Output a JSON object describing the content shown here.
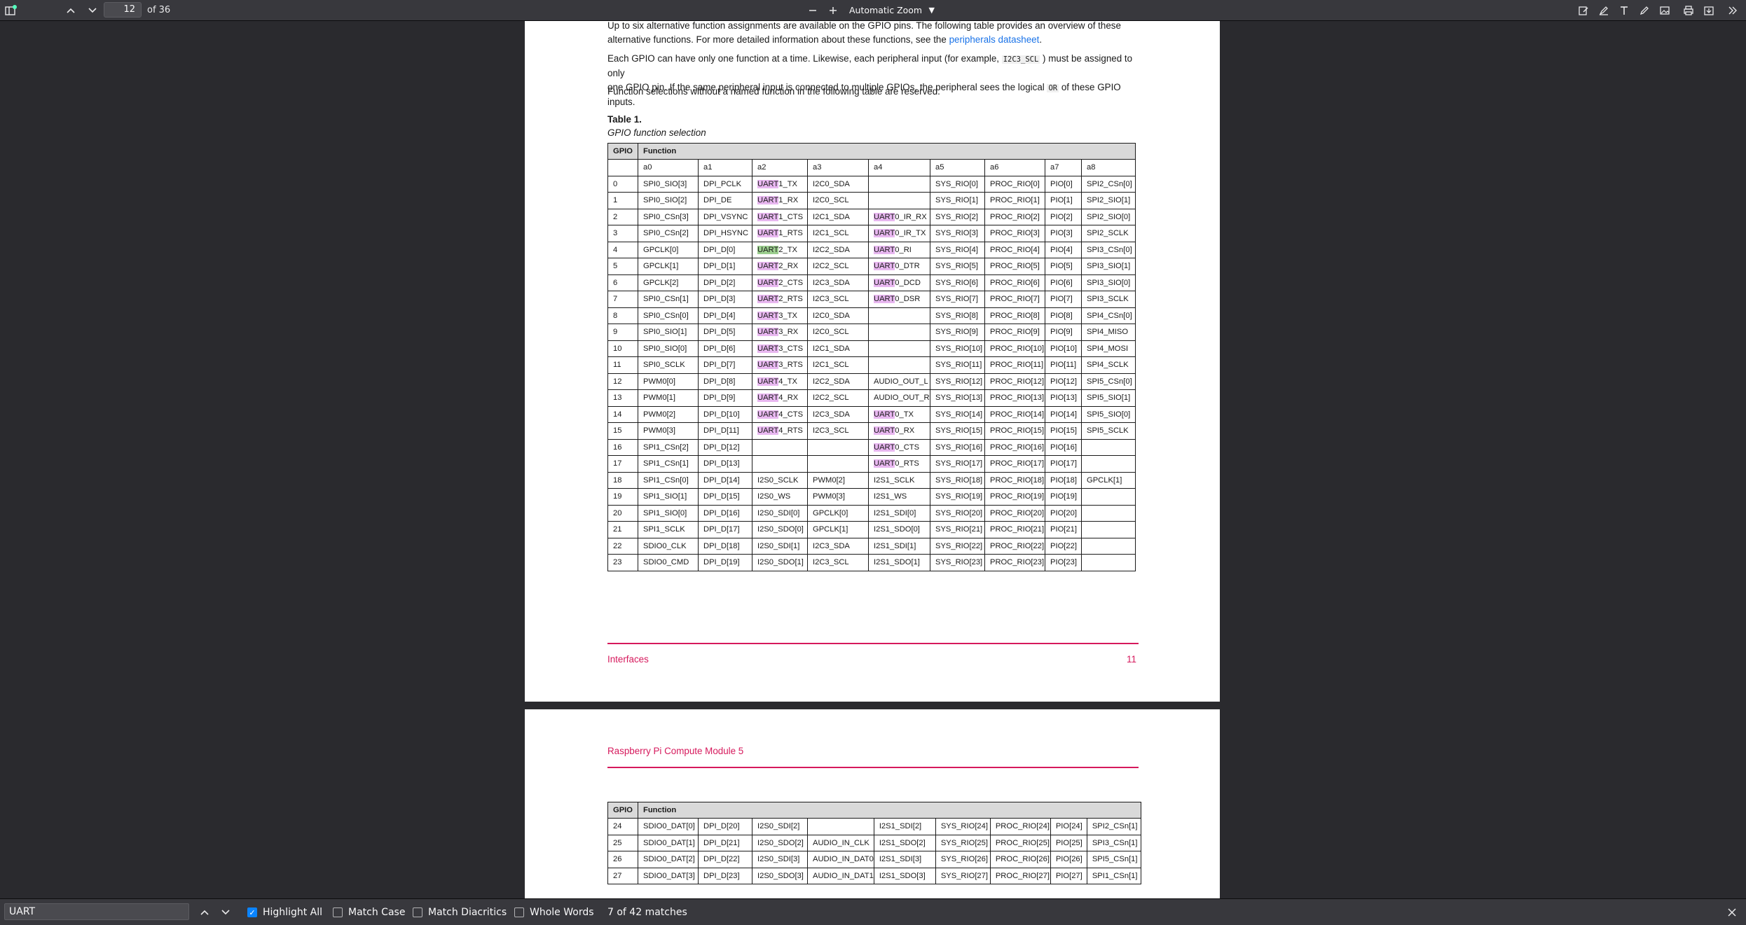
{
  "toolbar": {
    "page_number": "12",
    "page_count": "of 36",
    "zoom": "Automatic Zoom",
    "icons": [
      "sidebar-toggle-icon",
      "previous-page-icon",
      "next-page-icon",
      "zoom-out-icon",
      "zoom-in-icon",
      "annotate-icon",
      "highlight-icon",
      "text-icon",
      "draw-icon",
      "image-icon",
      "print-icon",
      "save-icon",
      "tools-menu-icon"
    ]
  },
  "page1": {
    "para1_a": "Up to six alternative function assignments are available on the GPIO pins. The following table provides an overview of these",
    "para1_b": "alternative functions. For more detailed information about these functions, see the ",
    "para1_link": "peripherals datasheet",
    "para1_end": ".",
    "para2_a": "Each GPIO can have only one function at a time. Likewise, each peripheral input (for example, ",
    "para2_code": "I2C3_SCL",
    "para2_b": ") must be assigned to only",
    "para2_c": "one GPIO pin. If the same peripheral input is connected to multiple GPIOs, the peripheral sees the logical ",
    "para2_code2": "OR",
    "para2_d": " of these GPIO inputs.",
    "para3": "Function selections without a named function in the following table are reserved.",
    "table_label": "Table 1.",
    "table_caption": "GPIO function selection",
    "col_gpio": "GPIO",
    "col_function": "Function",
    "alt_headers": [
      "a0",
      "a1",
      "a2",
      "a3",
      "a4",
      "a5",
      "a6",
      "a7",
      "a8"
    ],
    "rows": [
      [
        "0",
        "SPI0_SIO[3]",
        "DPI_PCLK",
        "UART1_TX",
        "I2C0_SDA",
        "",
        "SYS_RIO[0]",
        "PROC_RIO[0]",
        "PIO[0]",
        "SPI2_CSn[0]"
      ],
      [
        "1",
        "SPI0_SIO[2]",
        "DPI_DE",
        "UART1_RX",
        "I2C0_SCL",
        "",
        "SYS_RIO[1]",
        "PROC_RIO[1]",
        "PIO[1]",
        "SPI2_SIO[1]"
      ],
      [
        "2",
        "SPI0_CSn[3]",
        "DPI_VSYNC",
        "UART1_CTS",
        "I2C1_SDA",
        "UART0_IR_RX",
        "SYS_RIO[2]",
        "PROC_RIO[2]",
        "PIO[2]",
        "SPI2_SIO[0]"
      ],
      [
        "3",
        "SPI0_CSn[2]",
        "DPI_HSYNC",
        "UART1_RTS",
        "I2C1_SCL",
        "UART0_IR_TX",
        "SYS_RIO[3]",
        "PROC_RIO[3]",
        "PIO[3]",
        "SPI2_SCLK"
      ],
      [
        "4",
        "GPCLK[0]",
        "DPI_D[0]",
        "UART2_TX",
        "I2C2_SDA",
        "UART0_RI",
        "SYS_RIO[4]",
        "PROC_RIO[4]",
        "PIO[4]",
        "SPI3_CSn[0]"
      ],
      [
        "5",
        "GPCLK[1]",
        "DPI_D[1]",
        "UART2_RX",
        "I2C2_SCL",
        "UART0_DTR",
        "SYS_RIO[5]",
        "PROC_RIO[5]",
        "PIO[5]",
        "SPI3_SIO[1]"
      ],
      [
        "6",
        "GPCLK[2]",
        "DPI_D[2]",
        "UART2_CTS",
        "I2C3_SDA",
        "UART0_DCD",
        "SYS_RIO[6]",
        "PROC_RIO[6]",
        "PIO[6]",
        "SPI3_SIO[0]"
      ],
      [
        "7",
        "SPI0_CSn[1]",
        "DPI_D[3]",
        "UART2_RTS",
        "I2C3_SCL",
        "UART0_DSR",
        "SYS_RIO[7]",
        "PROC_RIO[7]",
        "PIO[7]",
        "SPI3_SCLK"
      ],
      [
        "8",
        "SPI0_CSn[0]",
        "DPI_D[4]",
        "UART3_TX",
        "I2C0_SDA",
        "",
        "SYS_RIO[8]",
        "PROC_RIO[8]",
        "PIO[8]",
        "SPI4_CSn[0]"
      ],
      [
        "9",
        "SPI0_SIO[1]",
        "DPI_D[5]",
        "UART3_RX",
        "I2C0_SCL",
        "",
        "SYS_RIO[9]",
        "PROC_RIO[9]",
        "PIO[9]",
        "SPI4_MISO"
      ],
      [
        "10",
        "SPI0_SIO[0]",
        "DPI_D[6]",
        "UART3_CTS",
        "I2C1_SDA",
        "",
        "SYS_RIO[10]",
        "PROC_RIO[10]",
        "PIO[10]",
        "SPI4_MOSI"
      ],
      [
        "11",
        "SPI0_SCLK",
        "DPI_D[7]",
        "UART3_RTS",
        "I2C1_SCL",
        "",
        "SYS_RIO[11]",
        "PROC_RIO[11]",
        "PIO[11]",
        "SPI4_SCLK"
      ],
      [
        "12",
        "PWM0[0]",
        "DPI_D[8]",
        "UART4_TX",
        "I2C2_SDA",
        "AUDIO_OUT_L",
        "SYS_RIO[12]",
        "PROC_RIO[12]",
        "PIO[12]",
        "SPI5_CSn[0]"
      ],
      [
        "13",
        "PWM0[1]",
        "DPI_D[9]",
        "UART4_RX",
        "I2C2_SCL",
        "AUDIO_OUT_R",
        "SYS_RIO[13]",
        "PROC_RIO[13]",
        "PIO[13]",
        "SPI5_SIO[1]"
      ],
      [
        "14",
        "PWM0[2]",
        "DPI_D[10]",
        "UART4_CTS",
        "I2C3_SDA",
        "UART0_TX",
        "SYS_RIO[14]",
        "PROC_RIO[14]",
        "PIO[14]",
        "SPI5_SIO[0]"
      ],
      [
        "15",
        "PWM0[3]",
        "DPI_D[11]",
        "UART4_RTS",
        "I2C3_SCL",
        "UART0_RX",
        "SYS_RIO[15]",
        "PROC_RIO[15]",
        "PIO[15]",
        "SPI5_SCLK"
      ],
      [
        "16",
        "SPI1_CSn[2]",
        "DPI_D[12]",
        "",
        "",
        "UART0_CTS",
        "SYS_RIO[16]",
        "PROC_RIO[16]",
        "PIO[16]",
        ""
      ],
      [
        "17",
        "SPI1_CSn[1]",
        "DPI_D[13]",
        "",
        "",
        "UART0_RTS",
        "SYS_RIO[17]",
        "PROC_RIO[17]",
        "PIO[17]",
        ""
      ],
      [
        "18",
        "SPI1_CSn[0]",
        "DPI_D[14]",
        "I2S0_SCLK",
        "PWM0[2]",
        "I2S1_SCLK",
        "SYS_RIO[18]",
        "PROC_RIO[18]",
        "PIO[18]",
        "GPCLK[1]"
      ],
      [
        "19",
        "SPI1_SIO[1]",
        "DPI_D[15]",
        "I2S0_WS",
        "PWM0[3]",
        "I2S1_WS",
        "SYS_RIO[19]",
        "PROC_RIO[19]",
        "PIO[19]",
        ""
      ],
      [
        "20",
        "SPI1_SIO[0]",
        "DPI_D[16]",
        "I2S0_SDI[0]",
        "GPCLK[0]",
        "I2S1_SDI[0]",
        "SYS_RIO[20]",
        "PROC_RIO[20]",
        "PIO[20]",
        ""
      ],
      [
        "21",
        "SPI1_SCLK",
        "DPI_D[17]",
        "I2S0_SDO[0]",
        "GPCLK[1]",
        "I2S1_SDO[0]",
        "SYS_RIO[21]",
        "PROC_RIO[21]",
        "PIO[21]",
        ""
      ],
      [
        "22",
        "SDIO0_CLK",
        "DPI_D[18]",
        "I2S0_SDI[1]",
        "I2C3_SDA",
        "I2S1_SDI[1]",
        "SYS_RIO[22]",
        "PROC_RIO[22]",
        "PIO[22]",
        ""
      ],
      [
        "23",
        "SDIO0_CMD",
        "DPI_D[19]",
        "I2S0_SDO[1]",
        "I2C3_SCL",
        "I2S1_SDO[1]",
        "SYS_RIO[23]",
        "PROC_RIO[23]",
        "PIO[23]",
        ""
      ]
    ],
    "footer_left": "Interfaces",
    "footer_right": "11"
  },
  "page2": {
    "header": "Raspberry Pi Compute Module 5",
    "col_gpio": "GPIO",
    "col_function": "Function",
    "rows": [
      [
        "24",
        "SDIO0_DAT[0]",
        "DPI_D[20]",
        "I2S0_SDI[2]",
        "",
        "I2S1_SDI[2]",
        "SYS_RIO[24]",
        "PROC_RIO[24]",
        "PIO[24]",
        "SPI2_CSn[1]"
      ],
      [
        "25",
        "SDIO0_DAT[1]",
        "DPI_D[21]",
        "I2S0_SDO[2]",
        "AUDIO_IN_CLK",
        "I2S1_SDO[2]",
        "SYS_RIO[25]",
        "PROC_RIO[25]",
        "PIO[25]",
        "SPI3_CSn[1]"
      ],
      [
        "26",
        "SDIO0_DAT[2]",
        "DPI_D[22]",
        "I2S0_SDI[3]",
        "AUDIO_IN_DAT0",
        "I2S1_SDI[3]",
        "SYS_RIO[26]",
        "PROC_RIO[26]",
        "PIO[26]",
        "SPI5_CSn[1]"
      ],
      [
        "27",
        "SDIO0_DAT[3]",
        "DPI_D[23]",
        "I2S0_SDO[3]",
        "AUDIO_IN_DAT1",
        "I2S1_SDO[3]",
        "SYS_RIO[27]",
        "PROC_RIO[27]",
        "PIO[27]",
        "SPI1_CSn[1]"
      ]
    ]
  },
  "findbar": {
    "query": "UART",
    "highlight_all": "Highlight All",
    "match_case": "Match Case",
    "match_diacritics": "Match Diacritics",
    "whole_words": "Whole Words",
    "result": "7 of 42 matches",
    "highlight_color": "#e8b7f0",
    "selected_highlight_color": "#9ccf8f"
  }
}
